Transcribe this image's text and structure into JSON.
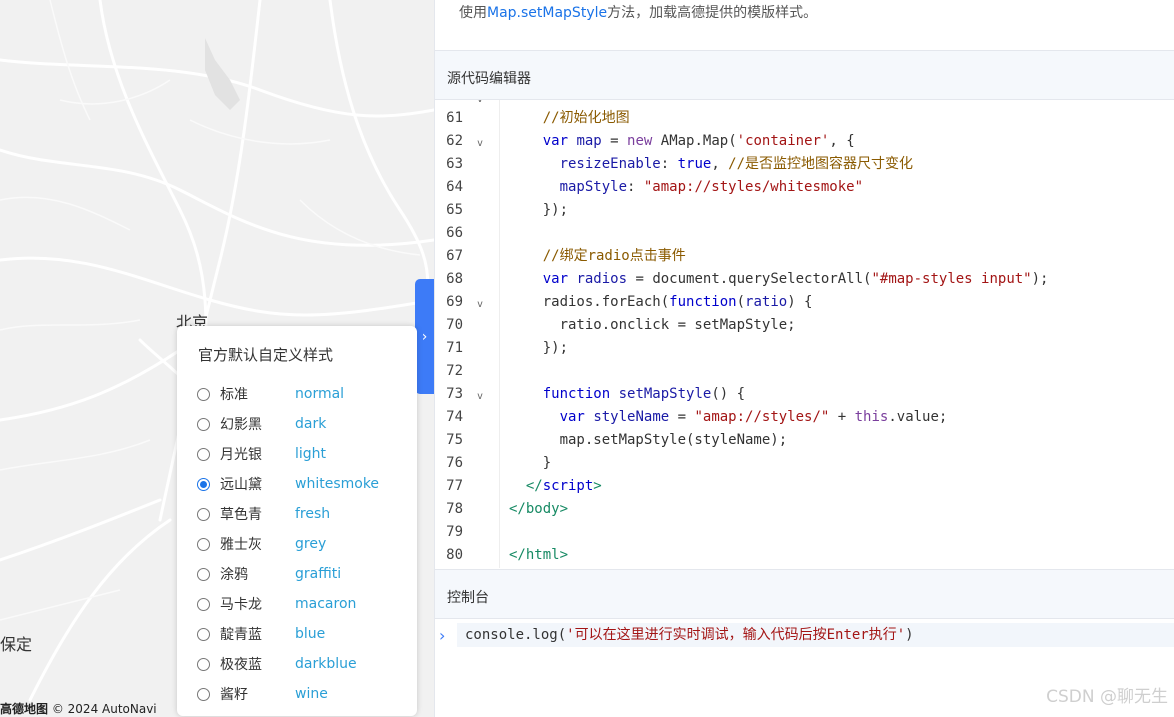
{
  "map": {
    "city_labels": [
      "北京",
      "保定"
    ],
    "footer_logo": "高德地图",
    "footer_copyright": "© 2024 AutoNavi"
  },
  "expand_handle": {
    "icon": "chevron-right-icon",
    "glyph": "›"
  },
  "style_panel": {
    "title": "官方默认自定义样式",
    "options": [
      {
        "cn": "标准",
        "en": "normal",
        "checked": false
      },
      {
        "cn": "幻影黑",
        "en": "dark",
        "checked": false
      },
      {
        "cn": "月光银",
        "en": "light",
        "checked": false
      },
      {
        "cn": "远山黛",
        "en": "whitesmoke",
        "checked": true
      },
      {
        "cn": "草色青",
        "en": "fresh",
        "checked": false
      },
      {
        "cn": "雅士灰",
        "en": "grey",
        "checked": false
      },
      {
        "cn": "涂鸦",
        "en": "graffiti",
        "checked": false
      },
      {
        "cn": "马卡龙",
        "en": "macaron",
        "checked": false
      },
      {
        "cn": "靛青蓝",
        "en": "blue",
        "checked": false
      },
      {
        "cn": "极夜蓝",
        "en": "darkblue",
        "checked": false
      },
      {
        "cn": "酱籽",
        "en": "wine",
        "checked": false
      }
    ]
  },
  "description": {
    "prefix": "使用",
    "method": "Map.setMapStyle",
    "suffix": "方法，加载高德提供的模版样式。"
  },
  "editor": {
    "header": "源代码编辑器",
    "lines": [
      {
        "n": "61",
        "fold": false,
        "tokens": [
          [
            "    ",
            ""
          ],
          [
            "//初始化地图",
            "cm"
          ]
        ]
      },
      {
        "n": "62",
        "fold": true,
        "tokens": [
          [
            "    ",
            ""
          ],
          [
            "var",
            "kw2"
          ],
          [
            " ",
            ""
          ],
          [
            "map",
            "var"
          ],
          [
            " = ",
            ""
          ],
          [
            "new",
            "kw"
          ],
          [
            " AMap.Map(",
            ""
          ],
          [
            "'container'",
            "str"
          ],
          [
            ", {",
            ""
          ]
        ]
      },
      {
        "n": "63",
        "fold": false,
        "tokens": [
          [
            "      ",
            ""
          ],
          [
            "resizeEnable",
            "prop"
          ],
          [
            ": ",
            ""
          ],
          [
            "true",
            "kw2"
          ],
          [
            ", ",
            ""
          ],
          [
            "//是否监控地图容器尺寸变化",
            "cm"
          ]
        ]
      },
      {
        "n": "64",
        "fold": false,
        "tokens": [
          [
            "      ",
            ""
          ],
          [
            "mapStyle",
            "prop"
          ],
          [
            ": ",
            ""
          ],
          [
            "\"amap://styles/whitesmoke\"",
            "str"
          ]
        ]
      },
      {
        "n": "65",
        "fold": false,
        "tokens": [
          [
            "    });",
            ""
          ]
        ]
      },
      {
        "n": "66",
        "fold": false,
        "tokens": []
      },
      {
        "n": "67",
        "fold": false,
        "tokens": [
          [
            "    ",
            ""
          ],
          [
            "//绑定radio点击事件",
            "cm"
          ]
        ]
      },
      {
        "n": "68",
        "fold": false,
        "tokens": [
          [
            "    ",
            ""
          ],
          [
            "var",
            "kw2"
          ],
          [
            " ",
            ""
          ],
          [
            "radios",
            "var"
          ],
          [
            " = document.querySelectorAll(",
            ""
          ],
          [
            "\"#map-styles input\"",
            "str"
          ],
          [
            ");",
            ""
          ]
        ]
      },
      {
        "n": "69",
        "fold": true,
        "tokens": [
          [
            "    radios.forEach(",
            ""
          ],
          [
            "function",
            "kw2"
          ],
          [
            "(",
            ""
          ],
          [
            "ratio",
            "var"
          ],
          [
            ") {",
            ""
          ]
        ]
      },
      {
        "n": "70",
        "fold": false,
        "tokens": [
          [
            "      ratio.onclick = setMapStyle;",
            ""
          ]
        ]
      },
      {
        "n": "71",
        "fold": false,
        "tokens": [
          [
            "    });",
            ""
          ]
        ]
      },
      {
        "n": "72",
        "fold": false,
        "tokens": []
      },
      {
        "n": "73",
        "fold": true,
        "tokens": [
          [
            "    ",
            ""
          ],
          [
            "function",
            "kw2"
          ],
          [
            " ",
            ""
          ],
          [
            "setMapStyle",
            "var"
          ],
          [
            "() {",
            ""
          ]
        ]
      },
      {
        "n": "74",
        "fold": false,
        "tokens": [
          [
            "      ",
            ""
          ],
          [
            "var",
            "kw2"
          ],
          [
            " ",
            ""
          ],
          [
            "styleName",
            "var"
          ],
          [
            " = ",
            ""
          ],
          [
            "\"amap://styles/\"",
            "str"
          ],
          [
            " + ",
            ""
          ],
          [
            "this",
            "kw"
          ],
          [
            ".value;",
            ""
          ]
        ]
      },
      {
        "n": "75",
        "fold": false,
        "tokens": [
          [
            "      map.setMapStyle(styleName);",
            ""
          ]
        ]
      },
      {
        "n": "76",
        "fold": false,
        "tokens": [
          [
            "    }",
            ""
          ]
        ]
      },
      {
        "n": "77",
        "fold": false,
        "tokens": [
          [
            "  </",
            "tag"
          ],
          [
            "script",
            "kw2"
          ],
          [
            ">",
            "tag"
          ]
        ]
      },
      {
        "n": "78",
        "fold": false,
        "tokens": [
          [
            "</",
            "tag"
          ],
          [
            "body",
            "tag"
          ],
          [
            ">",
            "tag"
          ]
        ]
      },
      {
        "n": "79",
        "fold": false,
        "tokens": []
      },
      {
        "n": "80",
        "fold": false,
        "tokens": [
          [
            "</",
            "tag"
          ],
          [
            "html",
            "tag"
          ],
          [
            ">",
            "tag"
          ]
        ]
      }
    ]
  },
  "console": {
    "header": "控制台",
    "prompt_icon": "chevron-right-icon",
    "input_fn": "console.log(",
    "input_str": "'可以在这里进行实时调试，输入代码后按Enter执行'",
    "input_end": ")"
  },
  "watermark": "CSDN @聊无生"
}
